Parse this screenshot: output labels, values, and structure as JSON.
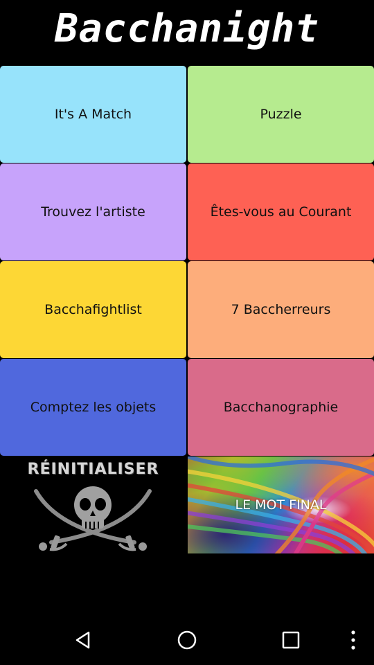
{
  "app": {
    "title": "Bacchanight"
  },
  "tiles": [
    {
      "label": "It's A Match",
      "color": "#97E3FB"
    },
    {
      "label": "Puzzle",
      "color": "#B6EB8F"
    },
    {
      "label": "Trouvez l'artiste",
      "color": "#C7A3FB"
    },
    {
      "label": "Êtes-vous au Courant",
      "color": "#FE6154"
    },
    {
      "label": "Bacchafightlist",
      "color": "#FDD735"
    },
    {
      "label": "7 Baccherreurs",
      "color": "#FDAD7B"
    },
    {
      "label": "Comptez les objets",
      "color": "#5068DD"
    },
    {
      "label": "Bacchanographie",
      "color": "#D96B8A"
    }
  ],
  "reset": {
    "label": "RÉINITIALISER",
    "icon": "pirate-skull-crossed-swords-icon"
  },
  "final": {
    "label": "LE MOT FINAL"
  },
  "navbar": {
    "back_icon": "back-triangle-icon",
    "home_icon": "home-circle-icon",
    "recents_icon": "recents-square-icon",
    "menu_icon": "overflow-menu-icon"
  }
}
